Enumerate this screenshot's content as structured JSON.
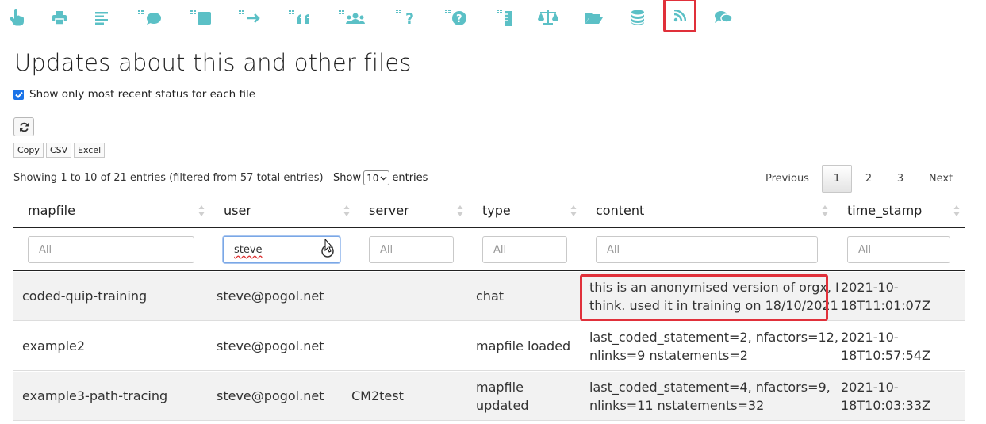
{
  "toolbar": {
    "icons": [
      "hand-pointer-icon",
      "print-icon",
      "align-left-icon",
      "table-comment-icon",
      "table-square-icon",
      "table-arrow-right-icon",
      "table-quote-icon",
      "table-users-icon",
      "table-question-icon",
      "table-question-circle-icon",
      "table-ruler-icon",
      "balance-scale-icon",
      "folder-open-icon",
      "database-icon",
      "rss-icon",
      "comments-icon"
    ],
    "active": "rss-icon",
    "icon_color": "#5bc0c6",
    "highlight_color": "#e0303a"
  },
  "page": {
    "title": "Updates about this and other files",
    "recent_checkbox_label": "Show only most recent status for each file",
    "recent_checked": true
  },
  "buttons": {
    "copy": "Copy",
    "csv": "CSV",
    "excel": "Excel"
  },
  "table_info": "Showing 1 to 10 of 21 entries (filtered from 57 total entries)",
  "length": {
    "show": "Show",
    "value": "10",
    "entries": "entries"
  },
  "pagination": {
    "previous": "Previous",
    "pages": [
      "1",
      "2",
      "3"
    ],
    "current": "1",
    "next": "Next"
  },
  "columns": [
    "mapfile",
    "user",
    "server",
    "type",
    "content",
    "time_stamp"
  ],
  "filters": {
    "placeholder": "All",
    "user_value": "steve"
  },
  "rows": [
    {
      "mapfile": "coded-quip-training",
      "user": "steve@pogol.net",
      "server": "",
      "type": "chat",
      "content_1": "this is an anonymised version of orgx, I",
      "content_2": "think. used it in training on 18/10/2021",
      "ts_1": "2021-10-",
      "ts_2": "18T11:01:07Z"
    },
    {
      "mapfile": "example2",
      "user": "steve@pogol.net",
      "server": "",
      "type": "mapfile loaded",
      "content_1": "last_coded_statement=2, nfactors=12,",
      "content_2": "nlinks=9 nstatements=2",
      "ts_1": "2021-10-",
      "ts_2": "18T10:57:54Z"
    },
    {
      "mapfile": "example3-path-tracing",
      "user": "steve@pogol.net",
      "server": "CM2test",
      "type_1": "mapfile",
      "type_2": "updated",
      "content_1": "last_coded_statement=4, nfactors=9,",
      "content_2": "nlinks=11 nstatements=32",
      "ts_1": "2021-10-",
      "ts_2": "18T10:03:33Z"
    }
  ]
}
